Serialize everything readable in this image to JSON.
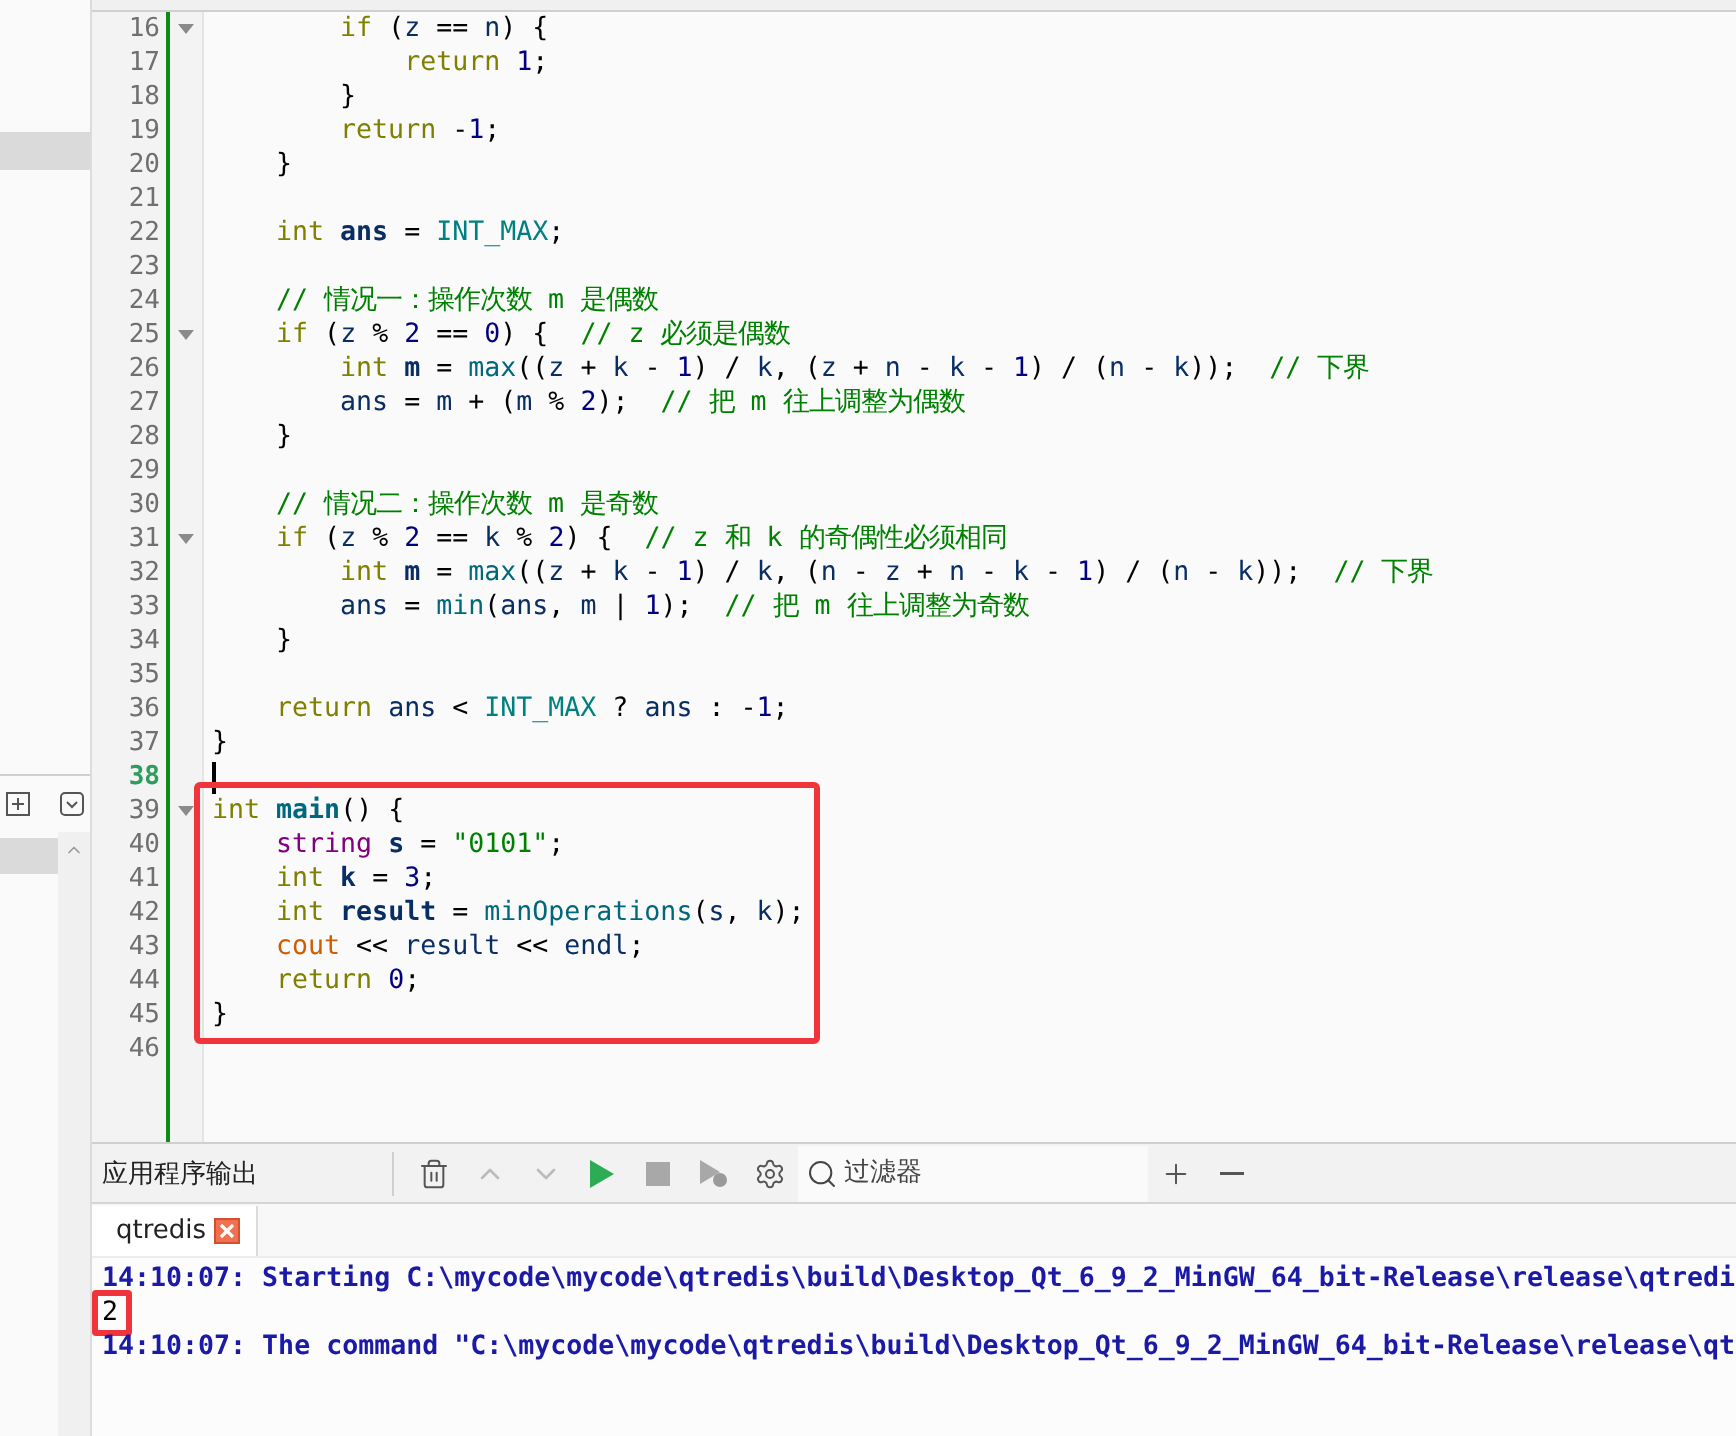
{
  "editor": {
    "blocks": [
      {
        "boxed": false,
        "lines": [
          {
            "number": "16",
            "fold": true,
            "current": false,
            "tokens": [
              {
                "t": "        if",
                "kind": "kw"
              },
              {
                "t": " (",
                "kind": "p"
              },
              {
                "t": "z",
                "kind": "v"
              },
              {
                "t": " == ",
                "kind": "p"
              },
              {
                "t": "n",
                "kind": "v"
              },
              {
                "t": ") {",
                "kind": "p"
              }
            ]
          },
          {
            "number": "17",
            "fold": false,
            "current": false,
            "tokens": [
              {
                "t": "            return ",
                "kind": "kw"
              },
              {
                "t": "1",
                "kind": "n"
              },
              {
                "t": ";",
                "kind": "p"
              }
            ]
          },
          {
            "number": "18",
            "fold": false,
            "current": false,
            "tokens": [
              {
                "t": "        }",
                "kind": "p"
              }
            ]
          },
          {
            "number": "19",
            "fold": false,
            "current": false,
            "tokens": [
              {
                "t": "        return",
                "kind": "kw"
              },
              {
                "t": " -",
                "kind": "p"
              },
              {
                "t": "1",
                "kind": "n"
              },
              {
                "t": ";",
                "kind": "p"
              }
            ]
          },
          {
            "number": "20",
            "fold": false,
            "current": false,
            "tokens": [
              {
                "t": "    }",
                "kind": "p"
              }
            ]
          },
          {
            "number": "21",
            "fold": false,
            "current": false
          },
          {
            "number": "22",
            "fold": false,
            "current": false,
            "tokens": [
              {
                "t": "    int ",
                "kind": "kw"
              },
              {
                "t": "ans",
                "kind": "dv"
              },
              {
                "t": " = ",
                "kind": "p"
              },
              {
                "t": "INT_MAX",
                "kind": "mc"
              },
              {
                "t": ";",
                "kind": "p"
              }
            ]
          },
          {
            "number": "23",
            "fold": false,
            "current": false
          },
          {
            "number": "24",
            "fold": false,
            "current": false,
            "tokens": [
              {
                "t": "    // 情况一：操作次数 m 是偶数",
                "kind": "c"
              }
            ]
          },
          {
            "number": "25",
            "fold": true,
            "current": false,
            "tokens": [
              {
                "t": "    if",
                "kind": "kw"
              },
              {
                "t": " (",
                "kind": "p"
              },
              {
                "t": "z",
                "kind": "v"
              },
              {
                "t": " % ",
                "kind": "p"
              },
              {
                "t": "2",
                "kind": "n"
              },
              {
                "t": " == ",
                "kind": "p"
              },
              {
                "t": "0",
                "kind": "n"
              },
              {
                "t": ") {  ",
                "kind": "p"
              },
              {
                "t": "// z 必须是偶数",
                "kind": "c"
              }
            ]
          },
          {
            "number": "26",
            "fold": false,
            "current": false,
            "tokens": [
              {
                "t": "        int ",
                "kind": "kw"
              },
              {
                "t": "m",
                "kind": "dv"
              },
              {
                "t": " = ",
                "kind": "p"
              },
              {
                "t": "max",
                "kind": "f"
              },
              {
                "t": "((",
                "kind": "p"
              },
              {
                "t": "z",
                "kind": "v"
              },
              {
                "t": " + ",
                "kind": "p"
              },
              {
                "t": "k",
                "kind": "v"
              },
              {
                "t": " - ",
                "kind": "p"
              },
              {
                "t": "1",
                "kind": "n"
              },
              {
                "t": ") / ",
                "kind": "p"
              },
              {
                "t": "k",
                "kind": "v"
              },
              {
                "t": ", (",
                "kind": "p"
              },
              {
                "t": "z",
                "kind": "v"
              },
              {
                "t": " + ",
                "kind": "p"
              },
              {
                "t": "n",
                "kind": "v"
              },
              {
                "t": " - ",
                "kind": "p"
              },
              {
                "t": "k",
                "kind": "v"
              },
              {
                "t": " - ",
                "kind": "p"
              },
              {
                "t": "1",
                "kind": "n"
              },
              {
                "t": ") / (",
                "kind": "p"
              },
              {
                "t": "n",
                "kind": "v"
              },
              {
                "t": " - ",
                "kind": "p"
              },
              {
                "t": "k",
                "kind": "v"
              },
              {
                "t": "));  ",
                "kind": "p"
              },
              {
                "t": "// 下界",
                "kind": "c"
              }
            ]
          },
          {
            "number": "27",
            "fold": false,
            "current": false,
            "tokens": [
              {
                "t": "        ans",
                "kind": "v"
              },
              {
                "t": " = ",
                "kind": "p"
              },
              {
                "t": "m",
                "kind": "v"
              },
              {
                "t": " + (",
                "kind": "p"
              },
              {
                "t": "m",
                "kind": "v"
              },
              {
                "t": " % ",
                "kind": "p"
              },
              {
                "t": "2",
                "kind": "n"
              },
              {
                "t": ");  ",
                "kind": "p"
              },
              {
                "t": "// 把 m 往上调整为偶数",
                "kind": "c"
              }
            ]
          },
          {
            "number": "28",
            "fold": false,
            "current": false,
            "tokens": [
              {
                "t": "    }",
                "kind": "p"
              }
            ]
          },
          {
            "number": "29",
            "fold": false,
            "current": false
          },
          {
            "number": "30",
            "fold": false,
            "current": false,
            "tokens": [
              {
                "t": "    // 情况二：操作次数 m 是奇数",
                "kind": "c"
              }
            ]
          },
          {
            "number": "31",
            "fold": true,
            "current": false,
            "tokens": [
              {
                "t": "    if",
                "kind": "kw"
              },
              {
                "t": " (",
                "kind": "p"
              },
              {
                "t": "z",
                "kind": "v"
              },
              {
                "t": " % ",
                "kind": "p"
              },
              {
                "t": "2",
                "kind": "n"
              },
              {
                "t": " == ",
                "kind": "p"
              },
              {
                "t": "k",
                "kind": "v"
              },
              {
                "t": " % ",
                "kind": "p"
              },
              {
                "t": "2",
                "kind": "n"
              },
              {
                "t": ") {  ",
                "kind": "p"
              },
              {
                "t": "// z 和 k 的奇偶性必须相同",
                "kind": "c"
              }
            ]
          },
          {
            "number": "32",
            "fold": false,
            "current": false,
            "tokens": [
              {
                "t": "        int ",
                "kind": "kw"
              },
              {
                "t": "m",
                "kind": "dv"
              },
              {
                "t": " = ",
                "kind": "p"
              },
              {
                "t": "max",
                "kind": "f"
              },
              {
                "t": "((",
                "kind": "p"
              },
              {
                "t": "z",
                "kind": "v"
              },
              {
                "t": " + ",
                "kind": "p"
              },
              {
                "t": "k",
                "kind": "v"
              },
              {
                "t": " - ",
                "kind": "p"
              },
              {
                "t": "1",
                "kind": "n"
              },
              {
                "t": ") / ",
                "kind": "p"
              },
              {
                "t": "k",
                "kind": "v"
              },
              {
                "t": ", (",
                "kind": "p"
              },
              {
                "t": "n",
                "kind": "v"
              },
              {
                "t": " - ",
                "kind": "p"
              },
              {
                "t": "z",
                "kind": "v"
              },
              {
                "t": " + ",
                "kind": "p"
              },
              {
                "t": "n",
                "kind": "v"
              },
              {
                "t": " - ",
                "kind": "p"
              },
              {
                "t": "k",
                "kind": "v"
              },
              {
                "t": " - ",
                "kind": "p"
              },
              {
                "t": "1",
                "kind": "n"
              },
              {
                "t": ") / (",
                "kind": "p"
              },
              {
                "t": "n",
                "kind": "v"
              },
              {
                "t": " - ",
                "kind": "p"
              },
              {
                "t": "k",
                "kind": "v"
              },
              {
                "t": "));  ",
                "kind": "p"
              },
              {
                "t": "// 下界",
                "kind": "c"
              }
            ]
          },
          {
            "number": "33",
            "fold": false,
            "current": false,
            "tokens": [
              {
                "t": "        ans",
                "kind": "v"
              },
              {
                "t": " = ",
                "kind": "p"
              },
              {
                "t": "min",
                "kind": "f"
              },
              {
                "t": "(",
                "kind": "p"
              },
              {
                "t": "ans",
                "kind": "v"
              },
              {
                "t": ", ",
                "kind": "p"
              },
              {
                "t": "m",
                "kind": "v"
              },
              {
                "t": " | ",
                "kind": "p"
              },
              {
                "t": "1",
                "kind": "n"
              },
              {
                "t": ");  ",
                "kind": "p"
              },
              {
                "t": "// 把 m 往上调整为奇数",
                "kind": "c"
              }
            ]
          },
          {
            "number": "34",
            "fold": false,
            "current": false,
            "tokens": [
              {
                "t": "    }",
                "kind": "p"
              }
            ]
          },
          {
            "number": "35",
            "fold": false,
            "current": false
          },
          {
            "number": "36",
            "fold": false,
            "current": false,
            "tokens": [
              {
                "t": "    return ",
                "kind": "kw"
              },
              {
                "t": "ans",
                "kind": "v"
              },
              {
                "t": " < ",
                "kind": "p"
              },
              {
                "t": "INT_MAX",
                "kind": "mc"
              },
              {
                "t": " ? ",
                "kind": "p"
              },
              {
                "t": "ans",
                "kind": "v"
              },
              {
                "t": " : -",
                "kind": "p"
              },
              {
                "t": "1",
                "kind": "n"
              },
              {
                "t": ";",
                "kind": "p"
              }
            ]
          },
          {
            "number": "37",
            "fold": false,
            "current": false,
            "tokens": [
              {
                "t": "}",
                "kind": "p"
              }
            ]
          },
          {
            "number": "38",
            "fold": false,
            "current": true
          }
        ]
      },
      {
        "boxed": true,
        "lines": [
          {
            "number": "39",
            "fold": true,
            "current": false,
            "tokens": [
              {
                "t": "int ",
                "kind": "kw"
              },
              {
                "t": "main",
                "kind": "fd"
              },
              {
                "t": "() {",
                "kind": "p"
              }
            ]
          },
          {
            "number": "40",
            "fold": false,
            "current": false,
            "tokens": [
              {
                "t": "    string ",
                "kind": "ty"
              },
              {
                "t": "s",
                "kind": "dv"
              },
              {
                "t": " = ",
                "kind": "p"
              },
              {
                "t": "\"0101\"",
                "kind": "s"
              },
              {
                "t": ";",
                "kind": "p"
              }
            ]
          },
          {
            "number": "41",
            "fold": false,
            "current": false,
            "tokens": [
              {
                "t": "    int ",
                "kind": "kw"
              },
              {
                "t": "k",
                "kind": "dv"
              },
              {
                "t": " = ",
                "kind": "p"
              },
              {
                "t": "3",
                "kind": "n"
              },
              {
                "t": ";",
                "kind": "p"
              }
            ]
          },
          {
            "number": "42",
            "fold": false,
            "current": false,
            "tokens": [
              {
                "t": "    int ",
                "kind": "kw"
              },
              {
                "t": "result",
                "kind": "dv"
              },
              {
                "t": " = ",
                "kind": "p"
              },
              {
                "t": "minOperations",
                "kind": "f"
              },
              {
                "t": "(",
                "kind": "p"
              },
              {
                "t": "s",
                "kind": "v"
              },
              {
                "t": ", ",
                "kind": "p"
              },
              {
                "t": "k",
                "kind": "v"
              },
              {
                "t": ");",
                "kind": "p"
              }
            ]
          },
          {
            "number": "43",
            "fold": false,
            "current": false,
            "tokens": [
              {
                "t": "    cout",
                "kind": "g"
              },
              {
                "t": " << ",
                "kind": "p"
              },
              {
                "t": "result",
                "kind": "v"
              },
              {
                "t": " << ",
                "kind": "p"
              },
              {
                "t": "endl",
                "kind": "v"
              },
              {
                "t": ";",
                "kind": "p"
              }
            ]
          },
          {
            "number": "44",
            "fold": false,
            "current": false,
            "tokens": [
              {
                "t": "    return ",
                "kind": "kw"
              },
              {
                "t": "0",
                "kind": "n"
              },
              {
                "t": ";",
                "kind": "p"
              }
            ]
          },
          {
            "number": "45",
            "fold": false,
            "current": false,
            "tokens": [
              {
                "t": "}",
                "kind": "p"
              }
            ]
          }
        ]
      },
      {
        "boxed": false,
        "lines": [
          {
            "number": "46",
            "fold": false,
            "current": false
          }
        ]
      }
    ]
  },
  "output": {
    "title": "应用程序输出",
    "filter": {
      "placeholder": "过滤器"
    },
    "tabs": [
      {
        "label": "qtredis",
        "selected": true
      }
    ],
    "lines": [
      {
        "kind": "message",
        "boxed": false,
        "text": "14:10:07: Starting C:\\mycode\\mycode\\qtredis\\build\\Desktop_Qt_6_9_2_MinGW_64_bit-Release\\release\\qtredi"
      },
      {
        "kind": "program",
        "boxed": true,
        "text": "2"
      },
      {
        "kind": "message",
        "boxed": false,
        "text": "14:10:07: The command \"C:\\mycode\\mycode\\qtredis\\build\\Desktop_Qt_6_9_2_MinGW_64_bit-Release\\release\\qt"
      }
    ]
  }
}
